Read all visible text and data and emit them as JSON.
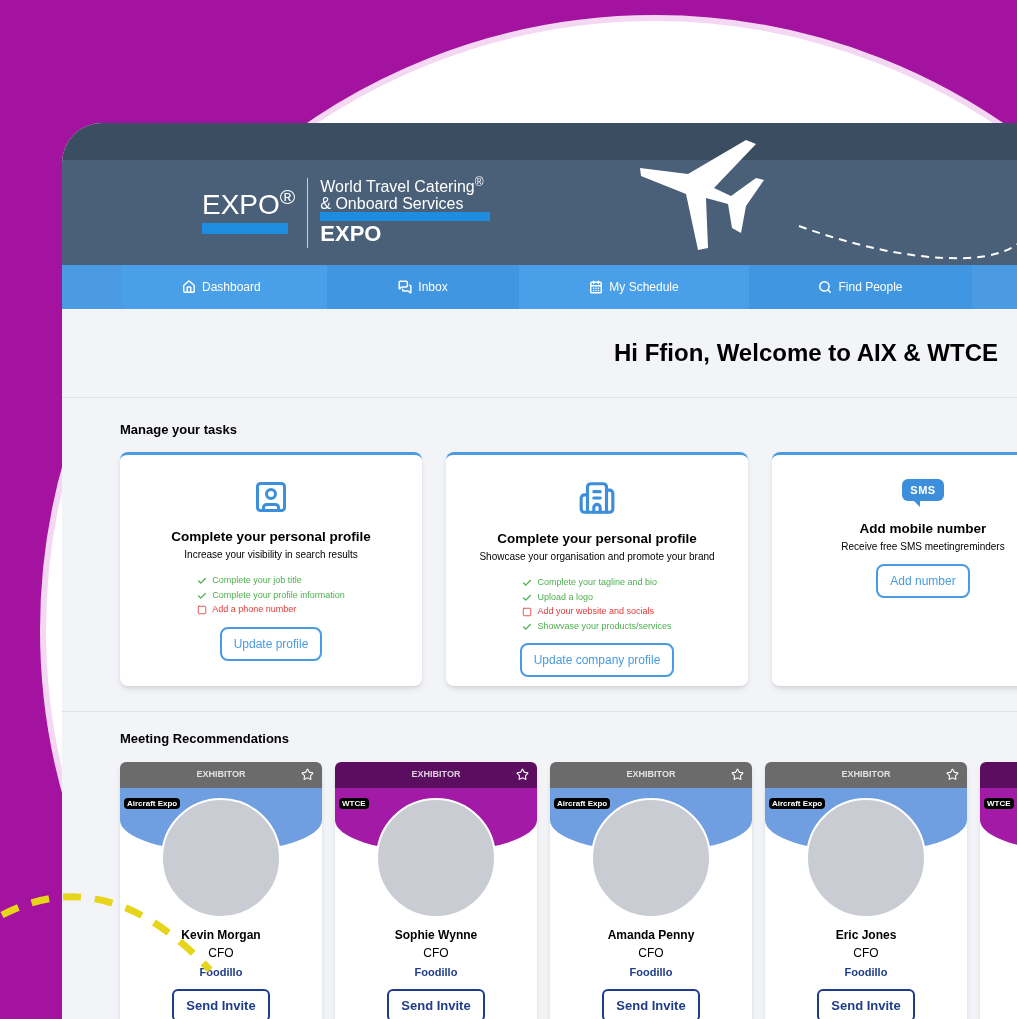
{
  "logo": {
    "left_mark": "EXPO$^{®}$",
    "title_line_1": "World Travel Catering$^{®}$",
    "title_line_2": "& Onboard Services",
    "title_line_3": "EXPO"
  },
  "nav": [
    {
      "label": "Dashboard"
    },
    {
      "label": "Inbox"
    },
    {
      "label": "My Schedule"
    },
    {
      "label": "Find People"
    }
  ],
  "greeting": "Hi Ffion, Welcome to AIX & WTCE",
  "tasks_heading": "Manage your tasks",
  "tasks": [
    {
      "title": "Complete your personal profile",
      "subtitle": "Increase your visibility in search results",
      "checklist": [
        {
          "text": "Complete your job title",
          "done": true
        },
        {
          "text": "Complete your profile information",
          "done": true
        },
        {
          "text": "Add a phone number",
          "done": false
        }
      ],
      "button": "Update profile"
    },
    {
      "title": "Complete your personal profile",
      "subtitle": "Showcase your organisation and promote your brand",
      "checklist": [
        {
          "text": "Complete your tagline and bio",
          "done": true
        },
        {
          "text": "Upload a logo",
          "done": true
        },
        {
          "text": "Add your website and socials",
          "done": false
        },
        {
          "text": "Showvase your products/services",
          "done": true
        }
      ],
      "button": "Update company profile"
    },
    {
      "icon_text": "SMS",
      "title": "Add mobile number",
      "subtitle": "Receive free SMS meetingreminders",
      "button": "Add number"
    }
  ],
  "recommendations_heading": "Meeting Recommendations",
  "people": [
    {
      "kind": "aircraft",
      "header": "EXHIBITOR",
      "tag": "Aircraft Expo",
      "name": "Kevin Morgan",
      "role": "CFO",
      "company": "Foodillo",
      "button": "Send Invite"
    },
    {
      "kind": "wtce",
      "header": "EXHIBITOR",
      "tag": "WTCE",
      "name": "Sophie Wynne",
      "role": "CFO",
      "company": "Foodillo",
      "button": "Send Invite"
    },
    {
      "kind": "aircraft",
      "header": "EXHIBITOR",
      "tag": "Aircraft Expo",
      "name": "Amanda Penny",
      "role": "CFO",
      "company": "Foodillo",
      "button": "Send Invite"
    },
    {
      "kind": "aircraft",
      "header": "EXHIBITOR",
      "tag": "Aircraft Expo",
      "name": "Eric Jones",
      "role": "CFO",
      "company": "Foodillo",
      "button": "Send Invite"
    },
    {
      "kind": "wtce",
      "tag": "WTCE"
    }
  ]
}
